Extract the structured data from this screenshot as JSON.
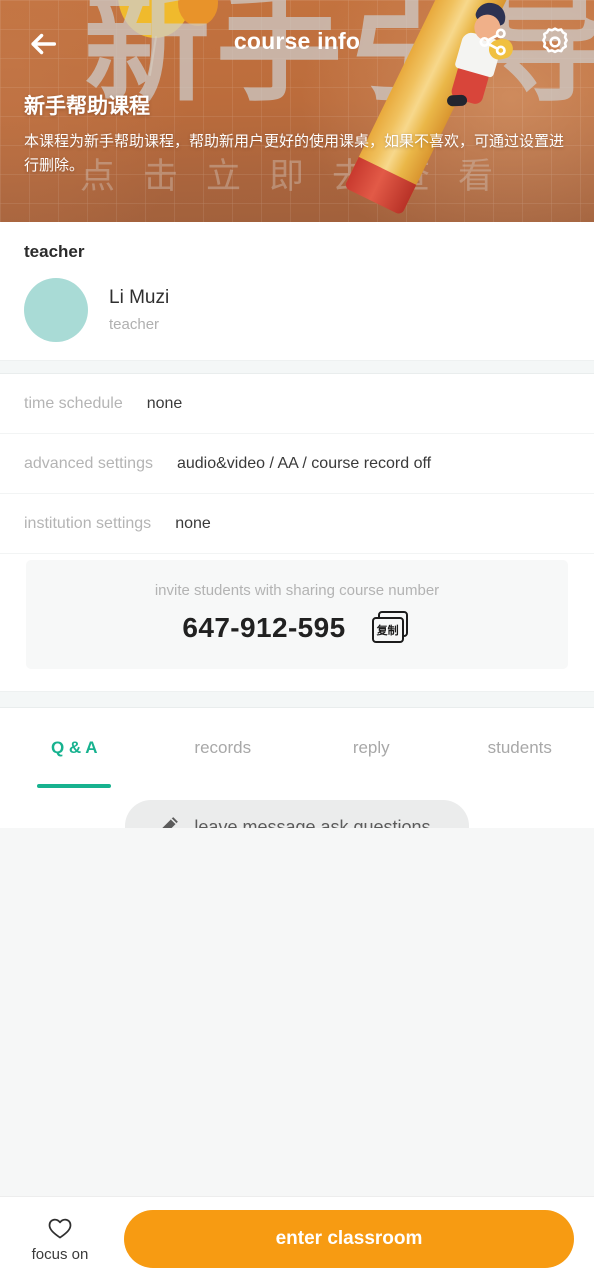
{
  "header": {
    "title": "course info",
    "back_icon": "back-arrow-icon",
    "share_icon": "share-icon",
    "settings_icon": "gear-icon",
    "course_title": "新手帮助课程",
    "course_description": "本课程为新手帮助课程，帮助新用户更好的使用课桌，如果不喜欢，可通过设置进行删除。",
    "watermark_text": "新手引导",
    "watermark_subtext": "点击立即去查看",
    "banner_color": "#b4673c"
  },
  "teacher_section": {
    "label": "teacher",
    "name": "Li Muzi",
    "role": "teacher",
    "avatar_color": "#a9dbd6"
  },
  "info_rows": [
    {
      "key": "time schedule",
      "value": "none"
    },
    {
      "key": "advanced settings",
      "value": "audio&video  / AA / course record off"
    },
    {
      "key": "institution settings",
      "value": "none"
    }
  ],
  "share_card": {
    "caption": "invite students with sharing course number",
    "course_number": "647-912-595",
    "copy_icon_label": "复制",
    "copy_icon": "copy-icon"
  },
  "tabs": [
    {
      "label": "Q & A",
      "active": true
    },
    {
      "label": "records",
      "active": false
    },
    {
      "label": "reply",
      "active": false
    },
    {
      "label": "students",
      "active": false
    }
  ],
  "tab_accent_color": "#17b28f",
  "message_button": {
    "label": "leave message,ask questions",
    "icon": "pencil-icon"
  },
  "bottom_bar": {
    "focus_label": "focus on",
    "focus_icon": "heart-outline-icon",
    "enter_label": "enter classroom",
    "enter_color": "#f79b12"
  }
}
